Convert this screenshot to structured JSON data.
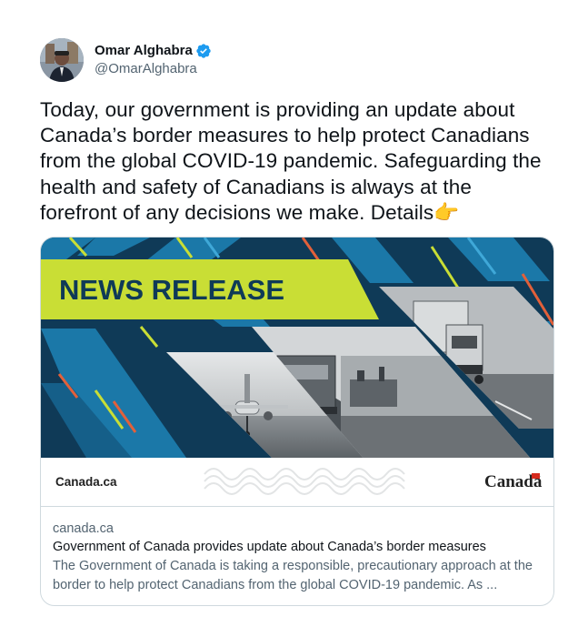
{
  "author": {
    "display_name": "Omar Alghabra",
    "handle": "@OmarAlghabra",
    "verified": true
  },
  "tweet": {
    "text": "Today, our government is providing an update about Canada’s border measures to help protect Canadians from the global COVID-19 pandemic. Safeguarding the health and safety of Canadians is always at the forefront of any decisions we make. Details👉"
  },
  "card": {
    "banner_text": "NEWS RELEASE",
    "footer_left": "Canada.ca",
    "footer_right": "Canadä",
    "domain": "canada.ca",
    "title": "Government of Canada provides update about Canada’s border measures",
    "description": "The Government of Canada is taking a responsible, precautionary approach at the border to help protect Canadians from the global COVID-19 pandemic. As ..."
  },
  "colors": {
    "verified_blue": "#1d9bf0",
    "banner_lime": "#c9de35",
    "deep_navy": "#0f3a57",
    "mid_blue": "#1b78a8"
  }
}
